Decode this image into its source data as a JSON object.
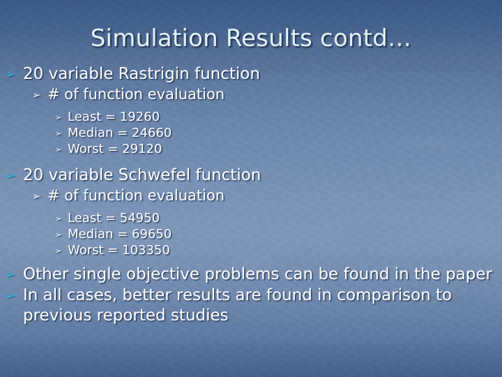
{
  "slide": {
    "title": "Simulation Results contd…",
    "background_color": "#6d88ad",
    "accent_bullet_color": "#29c3e8",
    "text_color": "#ffffff",
    "title_color": "#e2f2f8",
    "bullet_glyph_level1": "➢",
    "bullet_glyph_level2": "➢",
    "bullet_glyph_level3": "➢"
  },
  "outline": {
    "rastrigin": {
      "heading": "20 variable Rastrigin function",
      "subheading": "# of function evaluation",
      "stats": [
        "Least = 19260",
        "Median = 24660",
        "Worst = 29120"
      ]
    },
    "schwefel": {
      "heading": "20 variable Schwefel function",
      "subheading": "# of function evaluation",
      "stats": [
        "Least = 54950",
        "Median = 69650",
        "Worst = 103350"
      ]
    },
    "closing": [
      "Other single objective problems can be found in the paper",
      "In all cases, better results are found in comparison to previous reported studies"
    ]
  }
}
